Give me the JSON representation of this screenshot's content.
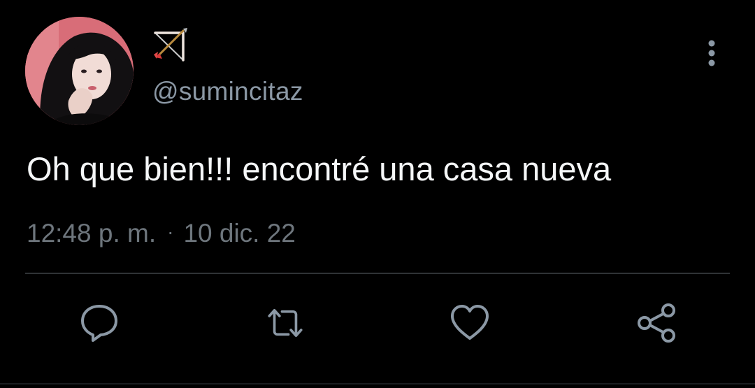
{
  "author": {
    "display_name": "🏹",
    "handle": "@sumincitaz"
  },
  "tweet": {
    "text": "Oh que bien!!! encontré una casa nueva",
    "time": "12:48 p. m.",
    "separator": "·",
    "date": "10 dic. 22"
  },
  "icons": {
    "avatar": "profile-photo",
    "display_name": "bow-and-arrow-emoji",
    "more": "vertical-ellipsis-icon",
    "reply": "reply-icon",
    "retweet": "retweet-icon",
    "like": "heart-icon",
    "share": "share-icon"
  },
  "colors": {
    "background": "#000000",
    "text": "#f5f7f8",
    "muted": "#6e767d",
    "handle": "#8b98a5",
    "icon": "#8b98a5",
    "divider": "#2f3336"
  }
}
